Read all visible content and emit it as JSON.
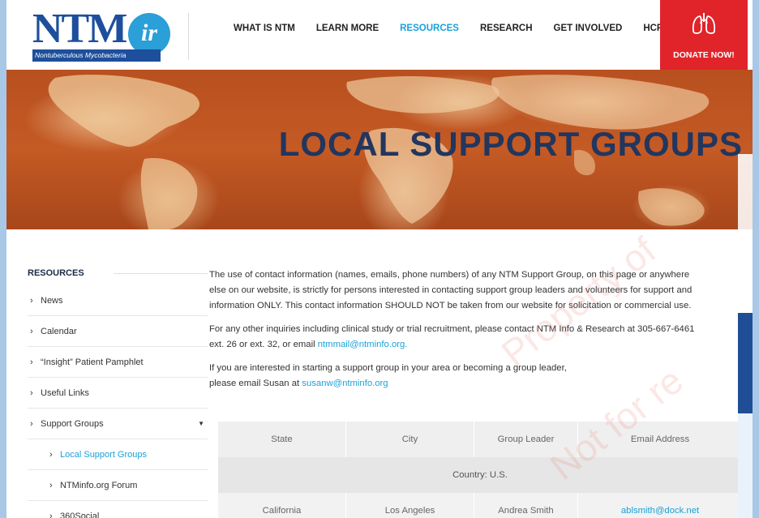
{
  "logo": {
    "wordmark": "NTM",
    "badge": "ir",
    "subtitle": "Nontuberculous Mycobacteria"
  },
  "nav": {
    "items": [
      {
        "label": "WHAT IS NTM",
        "active": false
      },
      {
        "label": "LEARN MORE",
        "active": false
      },
      {
        "label": "RESOURCES",
        "active": true
      },
      {
        "label": "RESEARCH",
        "active": false
      },
      {
        "label": "GET INVOLVED",
        "active": false
      },
      {
        "label": "HCP",
        "active": false
      }
    ],
    "donate_label": "DONATE NOW!",
    "donate_icon": "lungs-icon"
  },
  "hero": {
    "title": "LOCAL SUPPORT GROUPS"
  },
  "sidebar": {
    "heading": "RESOURCES",
    "items": [
      {
        "label": "News"
      },
      {
        "label": "Calendar"
      },
      {
        "label": "“Insight” Patient Pamphlet"
      },
      {
        "label": "Useful Links"
      },
      {
        "label": "Support Groups",
        "expanded": true
      }
    ],
    "subitems": [
      {
        "label": "Local Support Groups",
        "active": true
      },
      {
        "label": "NTMinfo.org Forum"
      },
      {
        "label": "360Social"
      }
    ]
  },
  "content": {
    "para1_line1": "The use of contact information (names, emails, phone numbers) of any NTM Support Group, on this page or anywhere",
    "para1_line2": "else on our website, is strictly for persons interested in contacting support group leaders and volunteers for support and",
    "para1_line3": "information ONLY. This contact information SHOULD NOT be taken from our website for solicitation or commercial use.",
    "para2_line1": "For any other inquiries including clinical study or trial recruitment, please contact NTM Info & Research at 305-667-6461",
    "para2_line2": "ext. 26 or ext. 32, or email ",
    "para2_email": "ntmmail@ntminfo.org.",
    "para3_line1": "If you are interested in starting a support group in your area or becoming a group leader,",
    "para3_line2": "please email Susan at ",
    "para3_email": "susanw@ntminfo.org"
  },
  "table": {
    "headers": [
      "State",
      "City",
      "Group Leader",
      "Email Address"
    ],
    "country_label": "Country: U.S.",
    "rows": [
      {
        "state": "California",
        "city": "Los Angeles",
        "leader": "Andrea Smith",
        "email": "ablsmith@dock.net"
      }
    ]
  },
  "watermark": {
    "line1": "Property of",
    "line2": "Not for re"
  },
  "colors": {
    "accent": "#1aa1d9",
    "brand": "#1d4f9c",
    "donate": "#e0242a",
    "hero_title": "#22365e"
  }
}
